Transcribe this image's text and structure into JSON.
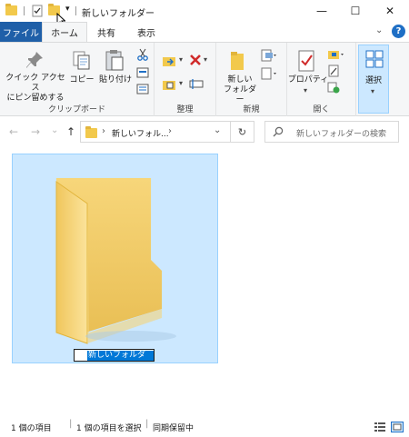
{
  "window": {
    "title": "新しいフォルダー",
    "minimize_glyph": "—",
    "maximize_glyph": "☐",
    "close_glyph": "✕"
  },
  "quick_access": {
    "dropdown_glyph": "▾"
  },
  "tabs": {
    "file": "ファイル",
    "home": "ホーム",
    "share": "共有",
    "view": "表示",
    "expand_glyph": "⌄",
    "help_glyph": "?"
  },
  "ribbon": {
    "clipboard": {
      "pin_label_line1": "クイック アクセス",
      "pin_label_line2": "にピン留めする",
      "copy_label": "コピー",
      "paste_label": "貼り付け",
      "group_label": "クリップボード"
    },
    "organize": {
      "group_label": "整理"
    },
    "new": {
      "new_folder_line1": "新しい",
      "new_folder_line2": "フォルダー",
      "group_label": "新規"
    },
    "open": {
      "properties_label": "プロパティ",
      "group_label": "開く"
    },
    "select": {
      "select_label": "選択"
    }
  },
  "nav": {
    "back_glyph": "←",
    "forward_glyph": "→",
    "recent_glyph": "⌄",
    "up_glyph": "↑",
    "breadcrumb_sep": "›",
    "breadcrumb_item": "新しいフォル...",
    "breadcrumb_sep2": "›",
    "address_dropdown": "⌄",
    "refresh_glyph": "↻",
    "search_placeholder": "新しいフォルダーの検索"
  },
  "content": {
    "item_name": "新しいフォルダー"
  },
  "status": {
    "item_count": "1 個の項目",
    "selected": "1 個の項目を選択",
    "sync": "同期保留中"
  },
  "colors": {
    "file_tab": "#1f5fa8",
    "selection": "#cce8ff",
    "accent": "#0078d7",
    "folder": "#f2c94c"
  }
}
